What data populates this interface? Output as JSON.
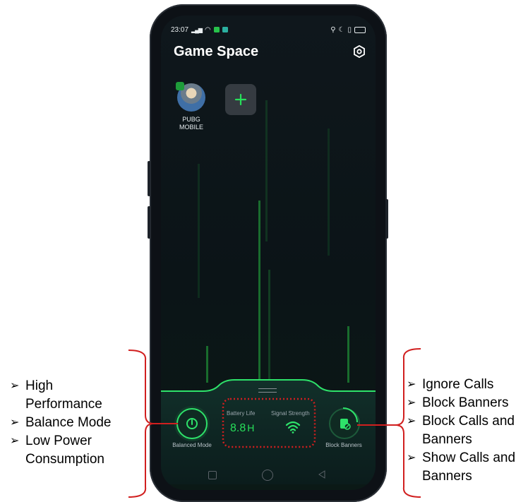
{
  "status": {
    "time": "23:07",
    "app_title": "Game Space"
  },
  "apps": [
    {
      "name_line1": "PUBG",
      "name_line2": "MOBILE"
    }
  ],
  "controls": {
    "mode_label": "Balanced Mode",
    "battery_title": "Battery Life",
    "battery_value": "8.8",
    "battery_unit": "H",
    "signal_title": "Signal Strength",
    "block_label": "Block Banners"
  },
  "left_annotations": [
    [
      "High",
      "Performance"
    ],
    [
      "Balance Mode"
    ],
    [
      "Low Power",
      "Consumption"
    ]
  ],
  "right_annotations": [
    [
      "Ignore Calls"
    ],
    [
      "Block Banners"
    ],
    [
      "Block Calls and",
      "Banners"
    ],
    [
      "Show Calls and",
      "Banners"
    ]
  ],
  "colors": {
    "accent": "#27e05a",
    "bracket": "#d11f1f"
  }
}
